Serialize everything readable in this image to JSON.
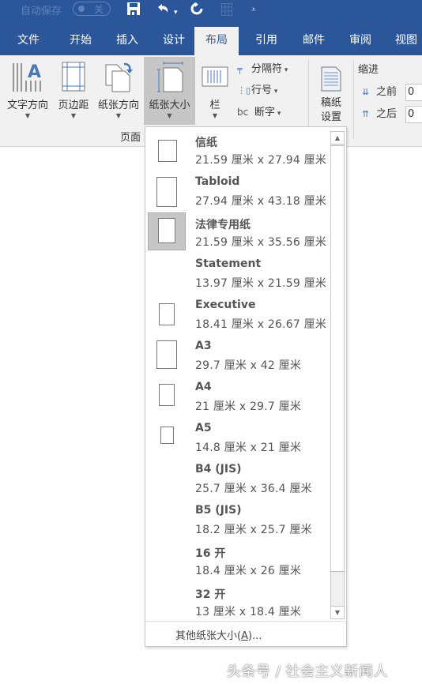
{
  "titlebar": {
    "autosave_label": "自动保存",
    "autosave_state": "关",
    "icons": [
      "save-icon",
      "undo-icon",
      "undo-dropdown-icon",
      "redo-icon",
      "table-icon",
      "customize-qat-icon"
    ]
  },
  "tabs": [
    {
      "label": "文件",
      "active": false
    },
    {
      "label": "开始",
      "active": false
    },
    {
      "label": "插入",
      "active": false
    },
    {
      "label": "设计",
      "active": false
    },
    {
      "label": "布局",
      "active": true
    },
    {
      "label": "引用",
      "active": false
    },
    {
      "label": "邮件",
      "active": false
    },
    {
      "label": "审阅",
      "active": false
    },
    {
      "label": "视图",
      "active": false
    }
  ],
  "ribbon": {
    "page_setup": {
      "group_label": "页面",
      "buttons": {
        "text_direction": "文字方向",
        "margins": "页边距",
        "orientation": "纸张方向",
        "size": "纸张大小",
        "columns": "栏"
      },
      "small_buttons": {
        "breaks": "分隔符",
        "line_numbers": "行号",
        "hyphenation": "断字"
      }
    },
    "manuscript": {
      "label_line1": "稿纸",
      "label_line2": "设置"
    },
    "paragraph": {
      "indent_label": "缩进",
      "before_label": "之前",
      "before_value": "0",
      "after_label": "之后",
      "after_value": "0"
    }
  },
  "paper_size_menu": {
    "selected_index": 2,
    "items": [
      {
        "name": "信纸",
        "dims": "21.59 厘米 x 27.94 厘米",
        "thumb": "letter"
      },
      {
        "name": "Tabloid",
        "dims": "27.94 厘米 x 43.18 厘米",
        "thumb": "tabloid"
      },
      {
        "name": "法律专用纸",
        "dims": "21.59 厘米 x 35.56 厘米",
        "thumb": "legal"
      },
      {
        "name": "Statement",
        "dims": "13.97 厘米 x 21.59 厘米",
        "thumb": "none"
      },
      {
        "name": "Executive",
        "dims": "18.41 厘米 x 26.67 厘米",
        "thumb": "executive"
      },
      {
        "name": "A3",
        "dims": "29.7 厘米 x 42 厘米",
        "thumb": "a3"
      },
      {
        "name": "A4",
        "dims": "21 厘米 x 29.7 厘米",
        "thumb": "a4"
      },
      {
        "name": "A5",
        "dims": "14.8 厘米 x 21 厘米",
        "thumb": "a5"
      },
      {
        "name": "B4 (JIS)",
        "dims": "25.7 厘米 x 36.4 厘米",
        "thumb": "none"
      },
      {
        "name": "B5 (JIS)",
        "dims": "18.2 厘米 x 25.7 厘米",
        "thumb": "none"
      },
      {
        "name": "16 开",
        "dims": "18.4 厘米 x 26 厘米",
        "thumb": "none"
      },
      {
        "name": "32 开",
        "dims": "13 厘米 x 18.4 厘米",
        "thumb": "none"
      }
    ],
    "more_label_prefix": "其他纸张大小(",
    "more_label_key": "A",
    "more_label_suffix": ")...",
    "scroll_up": "▲",
    "scroll_down": "▼"
  },
  "watermark": "头条号 / 社会主义新闻人"
}
